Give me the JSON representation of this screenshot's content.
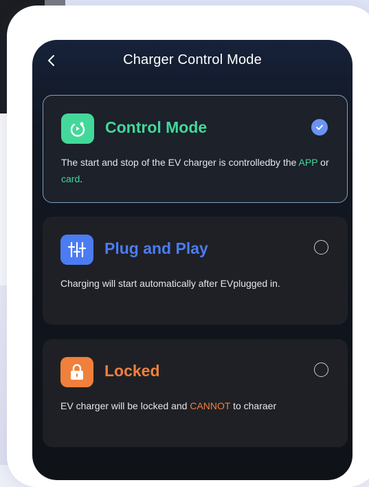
{
  "header": {
    "back_icon": "chevron-left-icon",
    "title": "Charger Control Mode"
  },
  "modes": [
    {
      "title": "Control Mode",
      "icon": "plug-power-icon",
      "color": "#43d89a",
      "selected": true,
      "desc_before": "The start and stop of the EV charger is controlledby the ",
      "desc_hl1": "APP",
      "desc_mid": " or ",
      "desc_hl2": "card",
      "desc_after": "."
    },
    {
      "title": "Plug and Play",
      "icon": "sliders-icon",
      "color": "#4b7cf2",
      "selected": false,
      "desc": "Charging will start automatically after EVplugged in."
    },
    {
      "title": "Locked",
      "icon": "lock-icon",
      "color": "#f0803c",
      "selected": false,
      "desc_before": "EV charger will be locked and ",
      "desc_hl": "CANNOT",
      "desc_after": " to charaer"
    }
  ],
  "colors": {
    "accent_blue": "#6b93f2",
    "green": "#43d89a",
    "orange": "#f0803c",
    "card_bg": "#1f2025"
  }
}
